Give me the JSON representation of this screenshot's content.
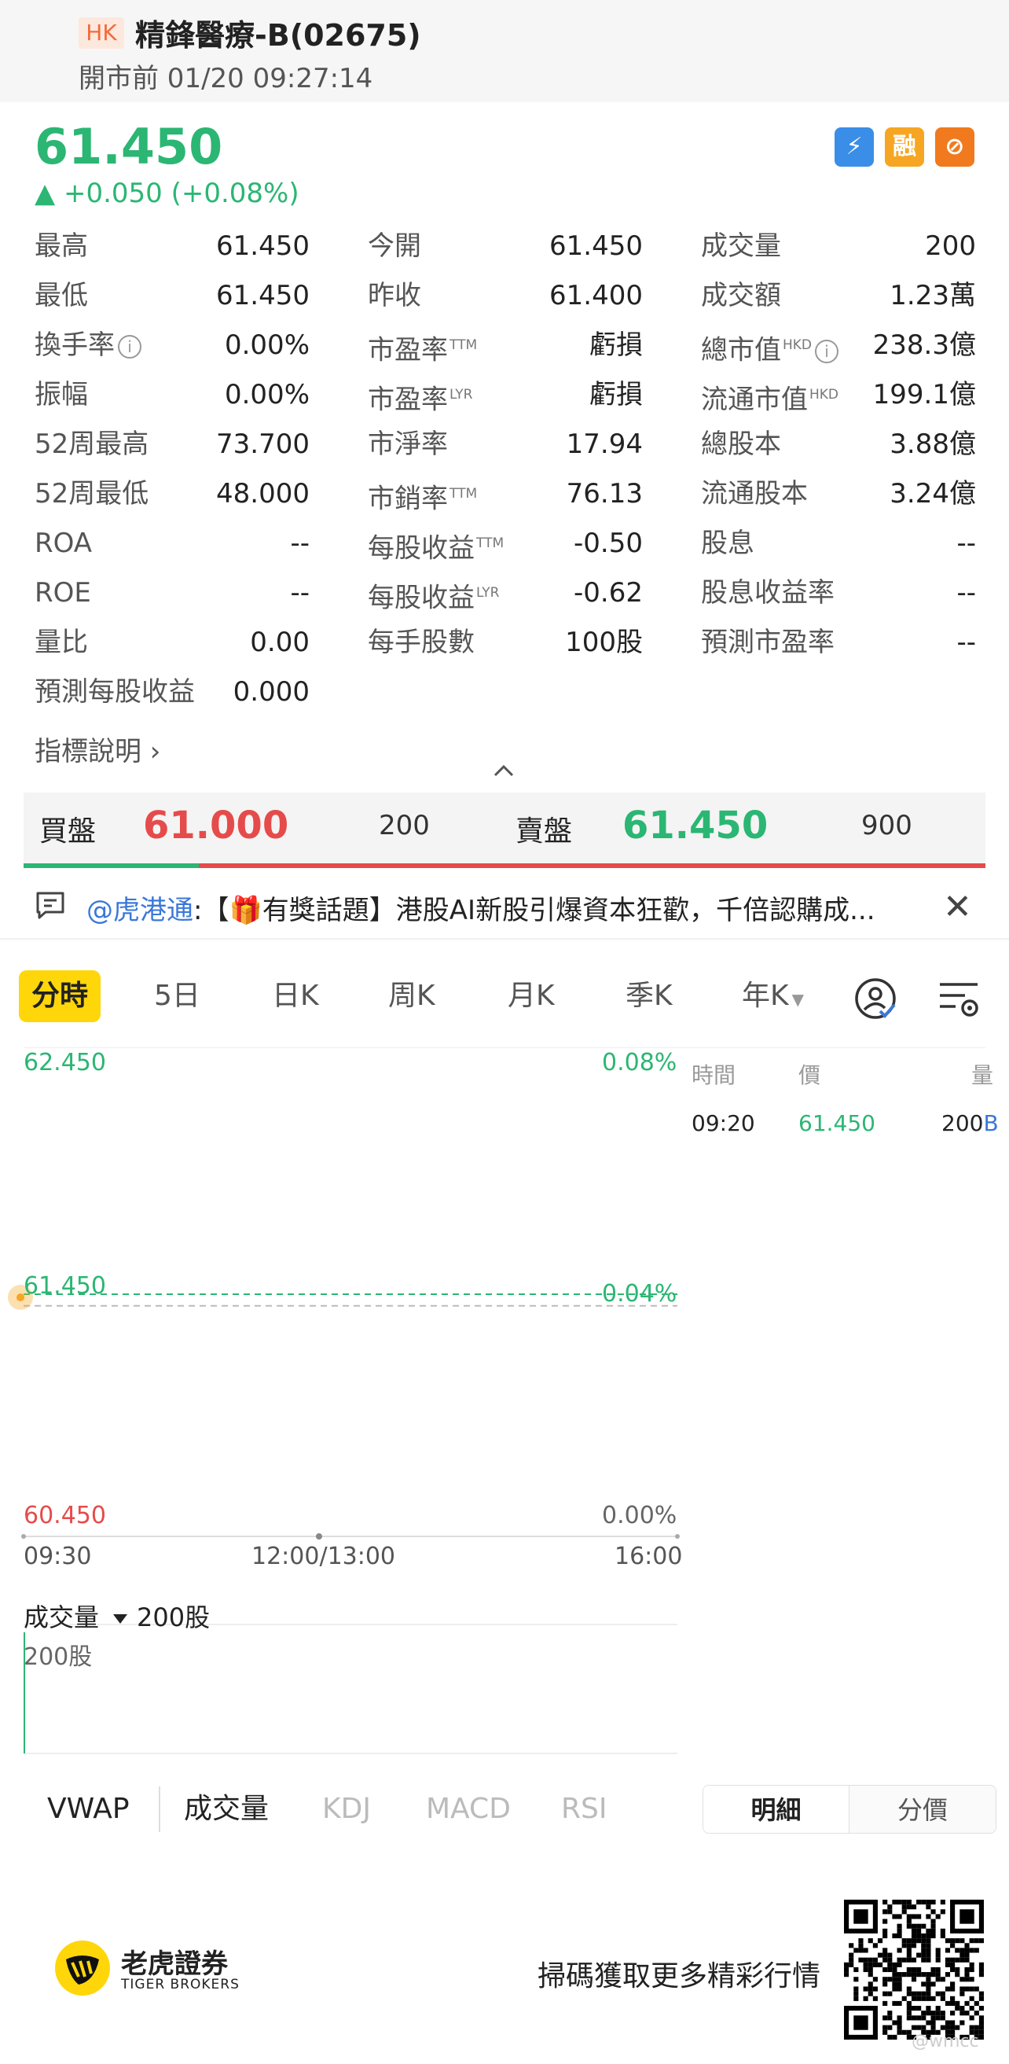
{
  "header": {
    "market_badge": "HK",
    "stock_name": "精鋒醫療-B(02675)",
    "status": "開市前 01/20 09:27:14"
  },
  "quote": {
    "price": "61.450",
    "change": "▲ +0.050 (+0.08%)",
    "up_color": "#2bb673",
    "down_color": "#e64b4b",
    "badges": [
      {
        "icon": "lightning-icon",
        "text": "⚡"
      },
      {
        "icon": "margin-icon",
        "text": "融"
      },
      {
        "icon": "no-short-icon",
        "text": "⊘"
      }
    ]
  },
  "stats": [
    [
      {
        "label": "最高",
        "value": "61.450"
      },
      {
        "label": "今開",
        "value": "61.450"
      },
      {
        "label": "成交量",
        "value": "200"
      }
    ],
    [
      {
        "label": "最低",
        "value": "61.450"
      },
      {
        "label": "昨收",
        "value": "61.400"
      },
      {
        "label": "成交額",
        "value": "1.23萬"
      }
    ],
    [
      {
        "label": "換手率",
        "value": "0.00%"
      },
      {
        "label": "市盈率",
        "sup": "TTM",
        "value": "虧損"
      },
      {
        "label": "總市值",
        "sup": "HKD",
        "value": "238.3億"
      }
    ],
    [
      {
        "label": "振幅",
        "value": "0.00%"
      },
      {
        "label": "市盈率",
        "sup": "LYR",
        "value": "虧損"
      },
      {
        "label": "流通市值",
        "sup": "HKD",
        "value": "199.1億"
      }
    ],
    [
      {
        "label": "52周最高",
        "value": "73.700"
      },
      {
        "label": "市淨率",
        "value": "17.94"
      },
      {
        "label": "總股本",
        "value": "3.88億"
      }
    ],
    [
      {
        "label": "52周最低",
        "value": "48.000"
      },
      {
        "label": "市銷率",
        "sup": "TTM",
        "value": "76.13"
      },
      {
        "label": "流通股本",
        "value": "3.24億"
      }
    ],
    [
      {
        "label": "ROA",
        "value": "--"
      },
      {
        "label": "每股收益",
        "sup": "TTM",
        "value": "-0.50"
      },
      {
        "label": "股息",
        "value": "--"
      }
    ],
    [
      {
        "label": "ROE",
        "value": "--"
      },
      {
        "label": "每股收益",
        "sup": "LYR",
        "value": "-0.62"
      },
      {
        "label": "股息收益率",
        "value": "--"
      }
    ],
    [
      {
        "label": "量比",
        "value": "0.00"
      },
      {
        "label": "每手股數",
        "value": "100股"
      },
      {
        "label": "預測市盈率",
        "value": "--"
      }
    ],
    [
      {
        "label": "預測每股收益",
        "value": "0.000"
      }
    ]
  ],
  "indicator_link": "指標說明 ›",
  "bid_ask": {
    "bid_label": "買盤",
    "bid_price": "61.000",
    "bid_volume": "200",
    "ask_label": "賣盤",
    "ask_price": "61.450",
    "ask_volume": "900",
    "bid_ratio": 0.182
  },
  "news": {
    "mention": "@虎港通",
    "text": ":【🎁有獎話題】港股AI新股引爆資本狂歡，千倍認購成..."
  },
  "chart_tabs": {
    "items": [
      "分時",
      "5日",
      "日K",
      "周K",
      "月K",
      "季K",
      "年K"
    ],
    "active": "分時"
  },
  "chart_data": {
    "type": "line",
    "y_left": [
      "62.450",
      "61.450",
      "60.450"
    ],
    "y_right": [
      "0.08%",
      "0.04%",
      "0.00%"
    ],
    "x_labels": [
      "09:30",
      "12:00/13:00",
      "16:00"
    ],
    "last_price": 61.45,
    "prev_close": 61.4,
    "ylim": [
      60.45,
      62.45
    ],
    "volume_title": "成交量",
    "volume_value": "200股",
    "volume_axis_label": "200股",
    "volume_bars": [
      200
    ]
  },
  "ticks": {
    "headers": [
      "時間",
      "價",
      "量"
    ],
    "rows": [
      {
        "time": "09:20",
        "price": "61.450",
        "volume": "200",
        "flag": "B"
      }
    ]
  },
  "indicators": {
    "items": [
      "VWAP",
      "成交量",
      "KDJ",
      "MACD",
      "RSI"
    ],
    "active": [
      "VWAP",
      "成交量"
    ]
  },
  "detail_toggle": {
    "on": "明細",
    "off": "分價"
  },
  "footer": {
    "brand_cn": "老虎證券",
    "brand_en": "TIGER BROKERS",
    "cta": "掃碼獲取更多精彩行情",
    "watermark": "@wmcc"
  }
}
